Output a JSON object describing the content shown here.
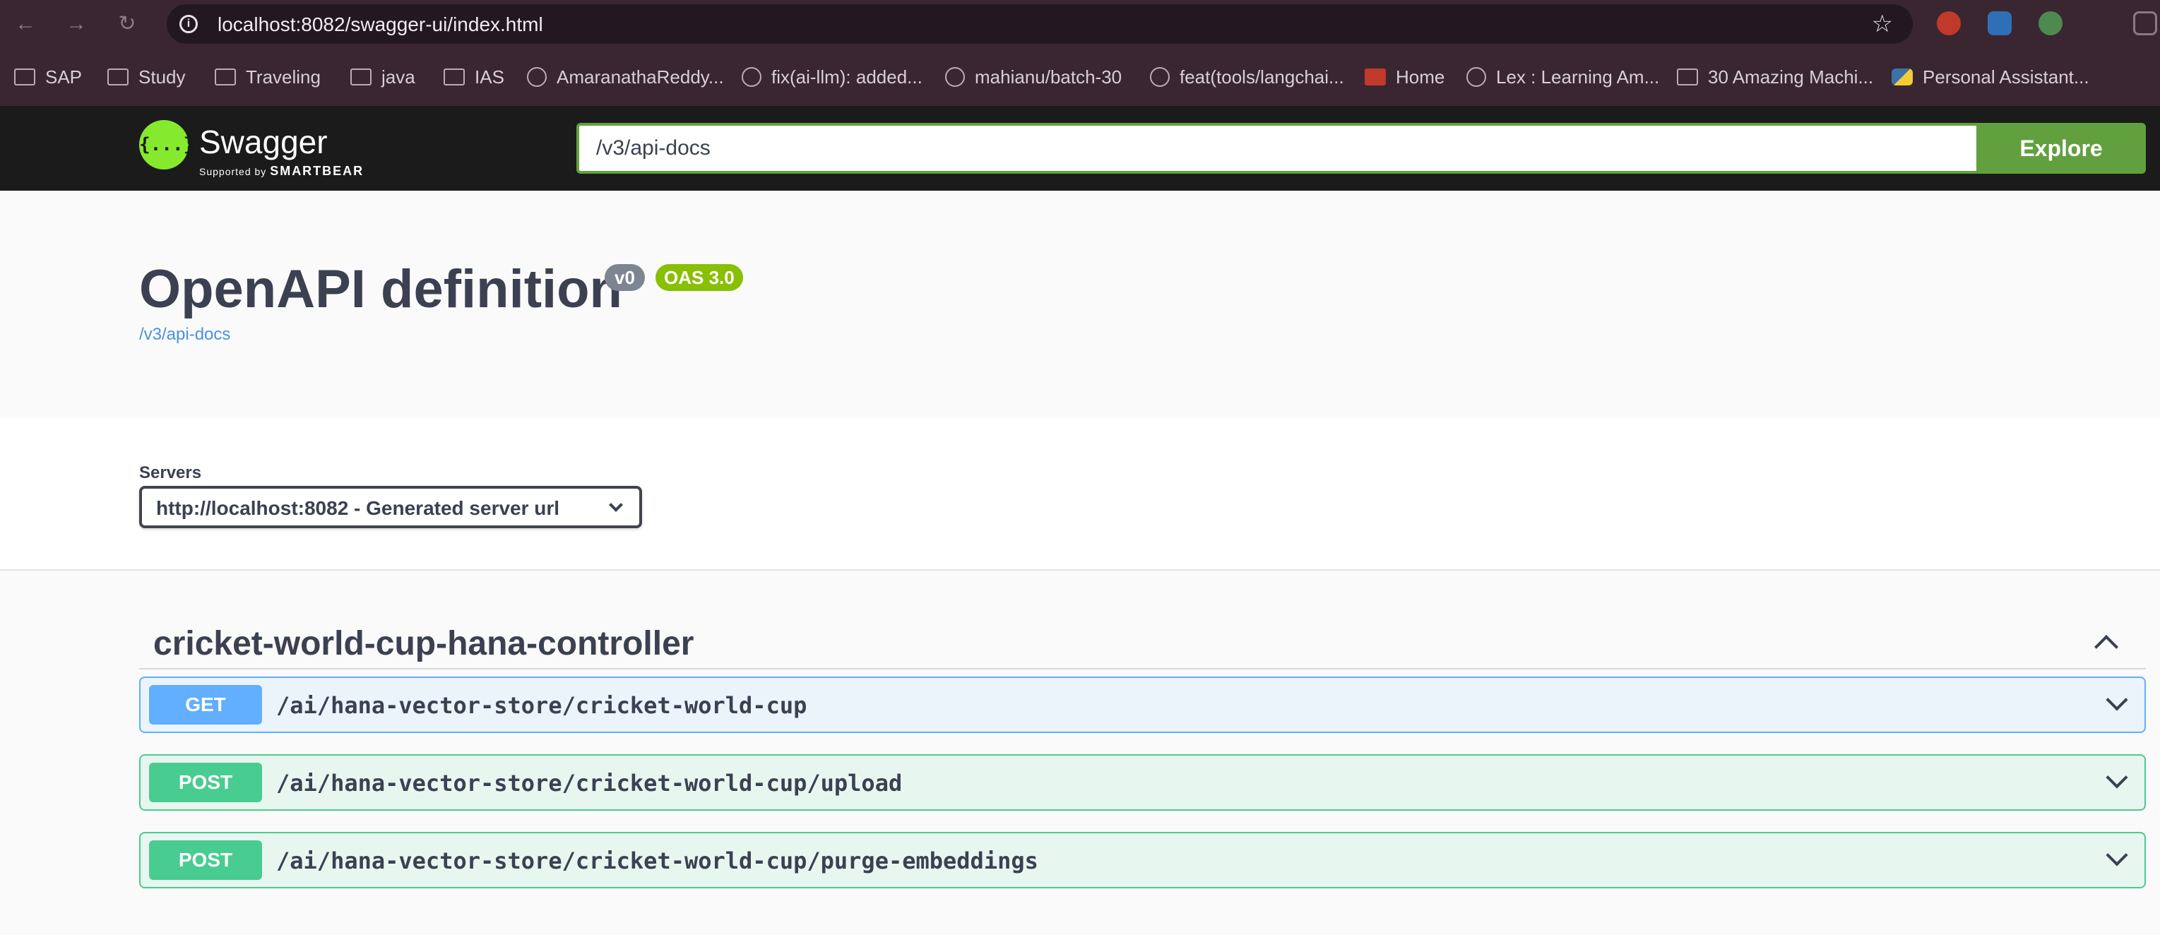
{
  "browser": {
    "url": "localhost:8082/swagger-ui/index.html",
    "bookmarks": [
      {
        "label": "SAP",
        "icon": "folder-icon"
      },
      {
        "label": "Study",
        "icon": "folder-icon"
      },
      {
        "label": "Traveling",
        "icon": "folder-icon"
      },
      {
        "label": "java",
        "icon": "folder-icon"
      },
      {
        "label": "IAS",
        "icon": "folder-icon"
      },
      {
        "label": "AmaranathaReddy...",
        "icon": "github-icon"
      },
      {
        "label": "fix(ai-llm): added...",
        "icon": "globe-icon"
      },
      {
        "label": "mahianu/batch-30",
        "icon": "github-icon"
      },
      {
        "label": "feat(tools/langchai...",
        "icon": "globe-icon"
      },
      {
        "label": "Home",
        "icon": "act-icon"
      },
      {
        "label": "Lex : Learning Am...",
        "icon": "lex-icon"
      },
      {
        "label": "30 Amazing Machi...",
        "icon": "page-icon"
      },
      {
        "label": "Personal Assistant...",
        "icon": "python-icon"
      }
    ]
  },
  "swagger": {
    "logo_text": "Swagger",
    "logo_sub_prefix": "Supported by",
    "logo_sub_brand": "SMARTBEAR",
    "logo_glyph": "{...}",
    "spec_url": "/v3/api-docs",
    "explore_label": "Explore"
  },
  "info": {
    "title": "OpenAPI definition",
    "version_badge": "v0",
    "oas_badge": "OAS 3.0",
    "link": "/v3/api-docs"
  },
  "servers": {
    "label": "Servers",
    "selected": "http://localhost:8082 - Generated server url"
  },
  "tag": {
    "name": "cricket-world-cup-hana-controller",
    "operations": [
      {
        "method": "GET",
        "path": "/ai/hana-vector-store/cricket-world-cup"
      },
      {
        "method": "POST",
        "path": "/ai/hana-vector-store/cricket-world-cup/upload"
      },
      {
        "method": "POST",
        "path": "/ai/hana-vector-store/cricket-world-cup/purge-embeddings"
      }
    ]
  },
  "colors": {
    "get": "#61affe",
    "post": "#49cc90",
    "explore": "#62a03f",
    "logo": "#85ea2d"
  }
}
